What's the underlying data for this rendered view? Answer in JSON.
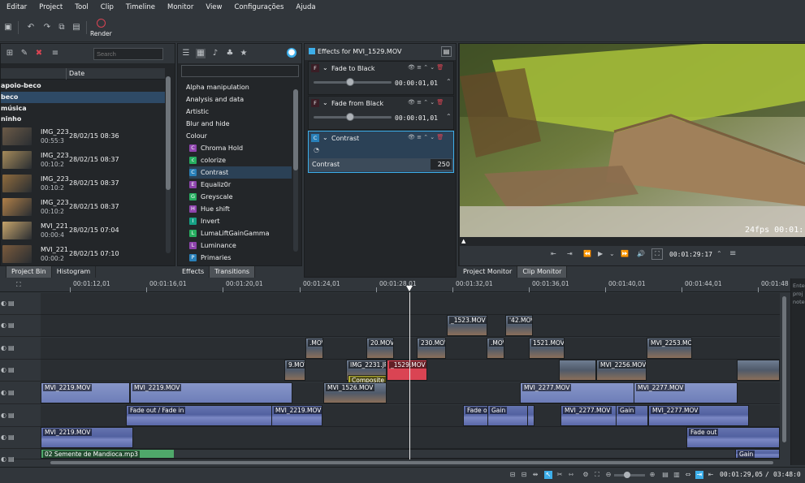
{
  "menu": [
    "Editar",
    "Project",
    "Tool",
    "Clip",
    "Timeline",
    "Monitor",
    "View",
    "Configurações",
    "Ajuda"
  ],
  "toolbar": {
    "render_label": "Render"
  },
  "bin": {
    "search_placeholder": "Search",
    "date_header": "Date",
    "folders": [
      "apoio-beco",
      "beco",
      "música",
      "ninho"
    ],
    "items": [
      {
        "name": "IMG_223",
        "dur": "00:55:3",
        "date": "28/02/15 08:36"
      },
      {
        "name": "IMG_223",
        "dur": "00:10:2",
        "date": "28/02/15 08:37"
      },
      {
        "name": "IMG_223",
        "dur": "00:10:2",
        "date": "28/02/15 08:37"
      },
      {
        "name": "IMG_223",
        "dur": "00:10:2",
        "date": "28/02/15 08:37"
      },
      {
        "name": "MVI_221",
        "dur": "00:00:4",
        "date": "28/02/15 07:04"
      },
      {
        "name": "MVI_221",
        "dur": "00:00:2",
        "date": "28/02/15 07:10"
      }
    ],
    "tabs": [
      "Project Bin",
      "Histogram"
    ]
  },
  "effects_list": {
    "categories": [
      "Alpha manipulation",
      "Analysis and data",
      "Artistic",
      "Blur and hide",
      "Colour"
    ],
    "items": [
      {
        "badge": "C",
        "color": "#8e44ad",
        "label": "Chroma Hold"
      },
      {
        "badge": "c",
        "color": "#27ae60",
        "label": "colorize"
      },
      {
        "badge": "C",
        "color": "#2980b9",
        "label": "Contrast"
      },
      {
        "badge": "E",
        "color": "#8e44ad",
        "label": "Equaliz0r"
      },
      {
        "badge": "G",
        "color": "#27ae60",
        "label": "Greyscale"
      },
      {
        "badge": "H",
        "color": "#8e44ad",
        "label": "Hue shift"
      },
      {
        "badge": "I",
        "color": "#16a085",
        "label": "Invert"
      },
      {
        "badge": "L",
        "color": "#27ae60",
        "label": "LumaLiftGainGamma"
      },
      {
        "badge": "L",
        "color": "#8e44ad",
        "label": "Luminance"
      },
      {
        "badge": "P",
        "color": "#2980b9",
        "label": "Primaries"
      }
    ],
    "tabs": [
      "Effects",
      "Transitions"
    ]
  },
  "effect_stack": {
    "title": "Effects for MVI_1529.MOV",
    "effects": [
      {
        "badge": "F",
        "name": "Fade to Black",
        "time": "00:00:01,01"
      },
      {
        "badge": "F",
        "name": "Fade from Black",
        "time": "00:00:01,01"
      },
      {
        "badge": "C",
        "name": "Contrast",
        "param": "Contrast",
        "value": "250"
      }
    ]
  },
  "monitor": {
    "overlay": "24fps 00:01:",
    "timecode": "00:01:29:17",
    "tabs": [
      "Project Monitor",
      "Clip Monitor"
    ]
  },
  "timeline": {
    "ruler": [
      "00:01:12,01",
      "00:01:16,01",
      "00:01:20,01",
      "00:01:24,01",
      "00:01:28,01",
      "00:01:32,01",
      "00:01:36,01",
      "00:01:40,01",
      "00:01:44,01",
      "00:01:48"
    ],
    "clips": {
      "t1a": "_1523.MOV",
      "t1b": "'42.MOV",
      "t2a": ".MOV",
      "t2b": "20.MOV",
      "t2c": "230.MOV",
      "t2d": ".MOV",
      "t2e": "1521.MOV",
      "t2f": "MVI_2253.MOV",
      "t3a": "9.MOV",
      "t3b": "IMG_2231.JPG",
      "t3c": "_1529.MOV",
      "t3d": "MVI_2256.MOV",
      "composite": "Composite",
      "t4a": "MVI_2219.MOV",
      "t4b": "MVI_2219.MOV",
      "t4c": "MVI_1526.MOV",
      "t4d": "MVI_2277.MOV",
      "t4e": "MVI_2277.MOV",
      "a1a": "Fade out / Fade in",
      "a1b": "MVI_2219.MOV",
      "a1c": "Fade out",
      "a1d": "Gain",
      "a1e": "MVI_2277.MOV",
      "a1f": "Gain",
      "a1g": "MVI_2277.MOV",
      "a2a": "MVI_2219.MOV",
      "a2b": "Fade out",
      "a3a": "02 Semente de Mandioca.mp3",
      "a3b": "Gain"
    }
  },
  "notes_preview": "Ente proj note",
  "status": {
    "position": "00:01:29,05",
    "duration": "03:48:0"
  }
}
